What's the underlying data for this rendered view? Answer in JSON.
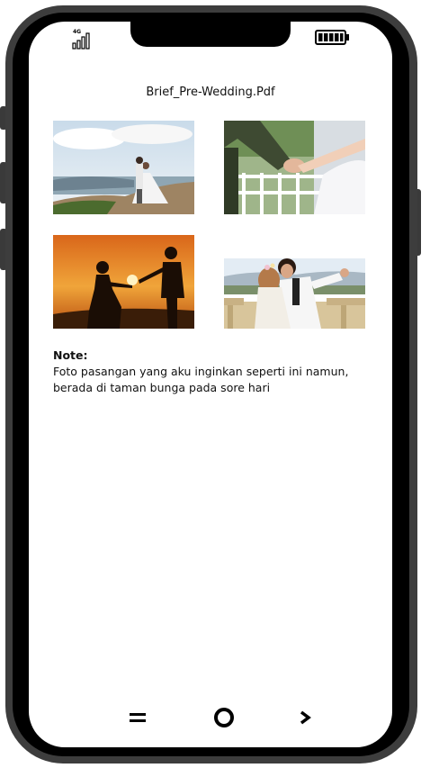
{
  "status_bar": {
    "network_label": "4G",
    "signal_icon": "signal-bars-icon",
    "battery_icon": "battery-icon"
  },
  "document": {
    "title": "Brief_Pre-Wedding.Pdf"
  },
  "photos": [
    {
      "name": "photo-couple-hilltop",
      "icon": "photo-wedding-hill"
    },
    {
      "name": "photo-holding-hands",
      "icon": "photo-holding-hands"
    },
    {
      "name": "photo-sunset-silhouette",
      "icon": "photo-sunset-silhouette"
    },
    {
      "name": "photo-couple-selfie",
      "icon": "photo-couple-balcony"
    }
  ],
  "note": {
    "label": "Note:",
    "text_line1": "Foto pasangan yang aku inginkan seperti ini namun,",
    "text_line2": "berada di taman bunga pada sore hari"
  },
  "nav": {
    "menu_icon": "menu-icon",
    "home_icon": "home-circle-icon",
    "back_icon": "chevron-right-icon"
  },
  "colors": {
    "frame": "#3d3d3d",
    "bezel": "#000000",
    "screen": "#ffffff",
    "text": "#111111",
    "sunset_orange": "#e88a1a"
  }
}
